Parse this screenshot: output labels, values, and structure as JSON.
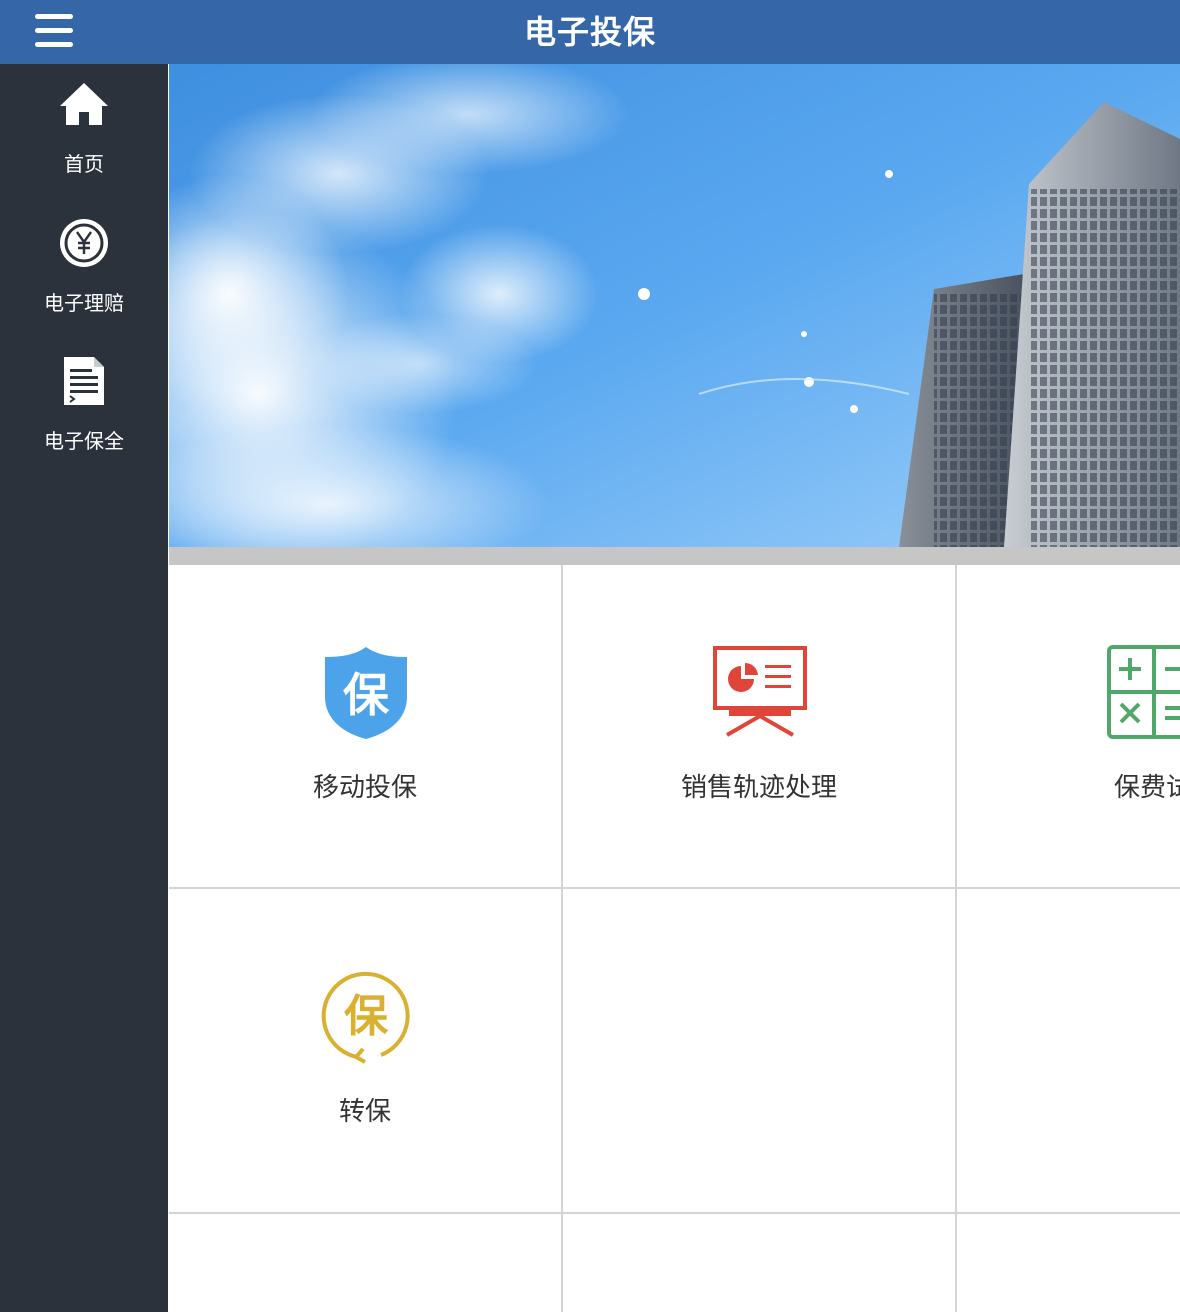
{
  "header": {
    "title": "电子投保",
    "menu_icon": "hamburger-menu-icon"
  },
  "sidebar": {
    "items": [
      {
        "label": "首页",
        "icon": "home-icon"
      },
      {
        "label": "电子理赔",
        "icon": "yen-coin-icon"
      },
      {
        "label": "电子保全",
        "icon": "document-icon"
      }
    ]
  },
  "tiles": [
    {
      "label": "移动投保",
      "icon": "bao-shield-icon",
      "color": "#4da3ea"
    },
    {
      "label": "销售轨迹处理",
      "icon": "presentation-chart-icon",
      "color": "#e0453a"
    },
    {
      "label": "保费试",
      "icon": "calculator-icon",
      "color": "#4fa86a"
    },
    {
      "label": "转保",
      "icon": "bao-circular-arrow-icon",
      "color": "#d9b030"
    }
  ],
  "colors": {
    "header": "#3566a8",
    "sidebar": "#2b323b",
    "divider": "#d4d4d4"
  }
}
